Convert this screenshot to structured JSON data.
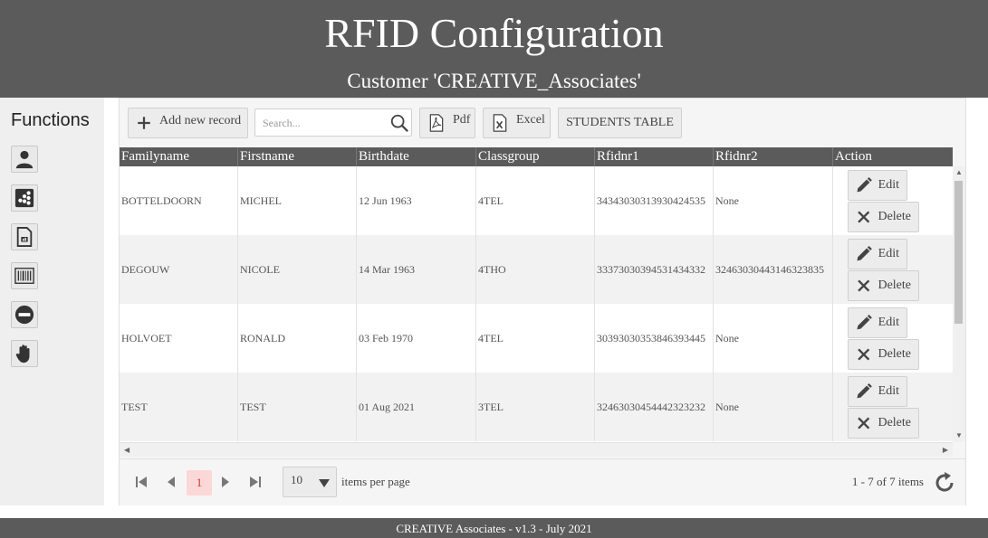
{
  "header": {
    "title": "RFID Configuration",
    "subtitle": "Customer 'CREATIVE_Associates'"
  },
  "sidebar": {
    "title": "Functions",
    "items": [
      {
        "icon": "user-icon"
      },
      {
        "icon": "dashboard-icon"
      },
      {
        "icon": "report-icon"
      },
      {
        "icon": "barcode-icon"
      },
      {
        "icon": "minus-circle-icon"
      },
      {
        "icon": "hand-icon"
      }
    ]
  },
  "toolbar": {
    "add_label": "Add new record",
    "search_placeholder": "Search...",
    "pdf_label": "Pdf",
    "excel_label": "Excel",
    "table_label": "STUDENTS TABLE"
  },
  "grid": {
    "columns": [
      "Familyname",
      "Firstname",
      "Birthdate",
      "Classgroup",
      "Rfidnr1",
      "Rfidnr2",
      "Action"
    ],
    "edit_label": "Edit",
    "delete_label": "Delete",
    "rows": [
      {
        "familyname": "BOTTELDOORN",
        "firstname": "MICHEL",
        "birthdate": "12 Jun 1963",
        "classgroup": "4TEL",
        "rfidnr1": "34343030313930424535",
        "rfidnr2": "None"
      },
      {
        "familyname": "DEGOUW",
        "firstname": "NICOLE",
        "birthdate": "14 Mar 1963",
        "classgroup": "4THO",
        "rfidnr1": "33373030394531434332",
        "rfidnr2": "32463030443146323835"
      },
      {
        "familyname": "HOLVOET",
        "firstname": "RONALD",
        "birthdate": "03 Feb 1970",
        "classgroup": "4TEL",
        "rfidnr1": "30393030353846393445",
        "rfidnr2": "None"
      },
      {
        "familyname": "TEST",
        "firstname": "TEST",
        "birthdate": "01 Aug 2021",
        "classgroup": "3TEL",
        "rfidnr1": "32463030454442323232",
        "rfidnr2": "None"
      }
    ]
  },
  "pager": {
    "current_page": "1",
    "page_size": "10",
    "items_per_page_label": "items per page",
    "info": "1 - 7 of 7 items"
  },
  "footer": {
    "text": "CREATIVE Associates - v1.3 - July 2021"
  },
  "colors": {
    "header_bg": "#5b5b5b",
    "active_page_bg": "#fbd7d7",
    "active_page_fg": "#cc3333"
  }
}
